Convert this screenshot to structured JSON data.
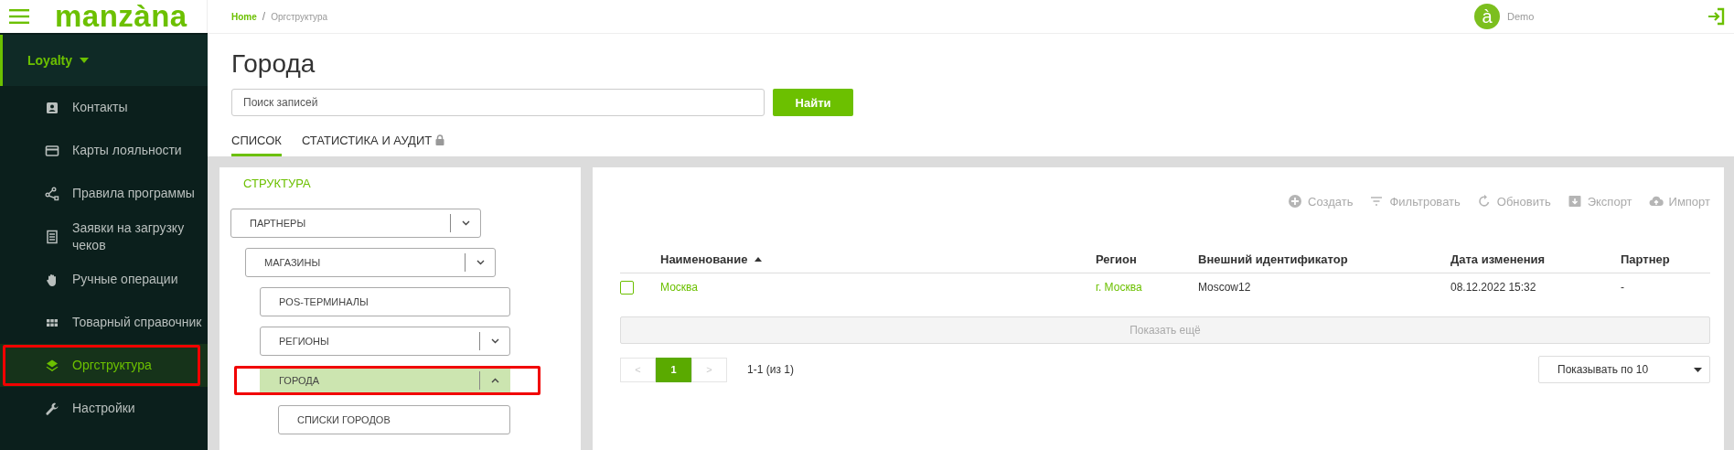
{
  "brand": "manzàna",
  "breadcrumbs": {
    "separator": "/",
    "items": [
      {
        "label": "Home",
        "link": true
      },
      {
        "label": "Оргструктура",
        "link": false
      }
    ]
  },
  "user": {
    "avatar_letter": "à",
    "role": "Demo"
  },
  "sidebar": {
    "section": {
      "label": "Loyalty",
      "expanded": true
    },
    "items": [
      {
        "label": "Контакты",
        "selected": false,
        "annotated": false
      },
      {
        "label": "Карты лояльности",
        "selected": false,
        "annotated": false
      },
      {
        "label": "Правила программы",
        "selected": false,
        "annotated": false
      },
      {
        "label": "Заявки на загрузку чеков",
        "selected": false,
        "annotated": false
      },
      {
        "label": "Ручные операции",
        "selected": false,
        "annotated": false
      },
      {
        "label": "Товарный справочник",
        "selected": false,
        "annotated": false
      },
      {
        "label": "Оргструктура",
        "selected": true,
        "annotated": true
      },
      {
        "label": "Настройки",
        "selected": false,
        "annotated": false
      }
    ]
  },
  "page_title": "Города",
  "search": {
    "placeholder": "Поиск записей",
    "button": "Найти"
  },
  "tabs": [
    {
      "label": "СПИСОК",
      "selected": true,
      "locked": false
    },
    {
      "label": "СТАТИСТИКА И АУДИТ",
      "selected": false,
      "locked": true
    }
  ],
  "structure": {
    "title": "СТРУКТУРА",
    "tree": [
      {
        "label": "ПАРТНЕРЫ",
        "has_toggle": true,
        "expanded": false,
        "selected": false,
        "annotated": false,
        "children": [
          {
            "label": "МАГАЗИНЫ",
            "has_toggle": true,
            "expanded": false,
            "selected": false,
            "annotated": false,
            "children": [
              {
                "label": "POS-ТЕРМИНАЛЫ",
                "has_toggle": false,
                "selected": false,
                "annotated": false
              },
              {
                "label": "РЕГИОНЫ",
                "has_toggle": true,
                "expanded": false,
                "selected": false,
                "annotated": false
              },
              {
                "label": "ГОРОДА",
                "has_toggle": true,
                "expanded": true,
                "selected": true,
                "annotated": true,
                "children": [
                  {
                    "label": "СПИСКИ ГОРОДОВ",
                    "has_toggle": false,
                    "selected": false,
                    "annotated": false
                  }
                ]
              }
            ]
          }
        ]
      }
    ]
  },
  "toolbar": [
    {
      "label": "Создать"
    },
    {
      "label": "Фильтровать"
    },
    {
      "label": "Обновить"
    },
    {
      "label": "Экспорт"
    },
    {
      "label": "Импорт"
    }
  ],
  "table": {
    "columns": [
      {
        "label": "Наименование",
        "sorted": true
      },
      {
        "label": "Регион",
        "sorted": false
      },
      {
        "label": "Внешний идентификатор",
        "sorted": false
      },
      {
        "label": "Дата изменения",
        "sorted": false
      },
      {
        "label": "Партнер",
        "sorted": false
      }
    ],
    "rows": [
      {
        "checked": false,
        "cells": [
          {
            "text": "Москва",
            "link": true
          },
          {
            "text": "г. Москва",
            "link": true
          },
          {
            "text": "Moscow12",
            "link": false
          },
          {
            "text": "08.12.2022 15:32",
            "link": false
          },
          {
            "text": "-",
            "link": false
          }
        ]
      }
    ]
  },
  "show_more": "Показать ещё",
  "pagination": {
    "prev": "<",
    "next": ">",
    "pages": [
      {
        "label": "1",
        "selected": true
      }
    ],
    "summary": "1-1 (из 1)",
    "page_size": "Показывать по 10"
  }
}
